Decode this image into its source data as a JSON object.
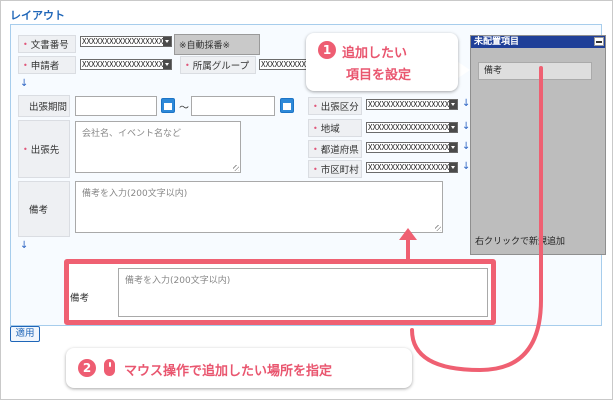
{
  "section_title": "レイアウト",
  "fields": {
    "doc_no_label": "文書番号",
    "doc_no_value": "XXXXXXXXXXXXXXXXXXXX",
    "auto_num": "※自動採番※",
    "applicant_label": "申請者",
    "applicant_value": "XXXXXXXXXXXXXXXXXXXX",
    "group_label": "所属グループ",
    "group_value": "XXXXXXXXXXXXXXXXXXXX",
    "trip_period_label": "出張期間",
    "tilde": "〜",
    "trip_dest_label": "出張先",
    "trip_dest_placeholder": "会社名、イベント名など",
    "remarks_label": "備考",
    "remarks_placeholder": "備考を入力(200文字以内)",
    "trip_type_label": "出張区分",
    "trip_type_value": "XXXXXXXXXXXXXXXXXXXX",
    "region_label": "地域",
    "region_value": "XXXXXXXXXXXXXXXXXXXX",
    "pref_label": "都道府県",
    "pref_value": "XXXXXXXXXXXXXXXXXXXX",
    "city_label": "市区町村",
    "city_value": "XXXXXXXXXXXXXXXXXXXX"
  },
  "unplaced_panel": {
    "title": "未配置項目",
    "item": "備考",
    "footer": "右クリックで新規追加"
  },
  "highlight": {
    "label": "備考",
    "placeholder": "備考を入力(200文字以内)"
  },
  "apply_button": "適用",
  "callouts": {
    "step1_number": "1",
    "step1_line1": "追加したい",
    "step1_line2": "項目を設定",
    "step2_number": "2",
    "step2_text": "マウス操作で追加したい場所を指定"
  },
  "colors": {
    "accent": "#ef6072",
    "header_blue": "#1f3f98",
    "link_blue": "#1f66b8"
  }
}
